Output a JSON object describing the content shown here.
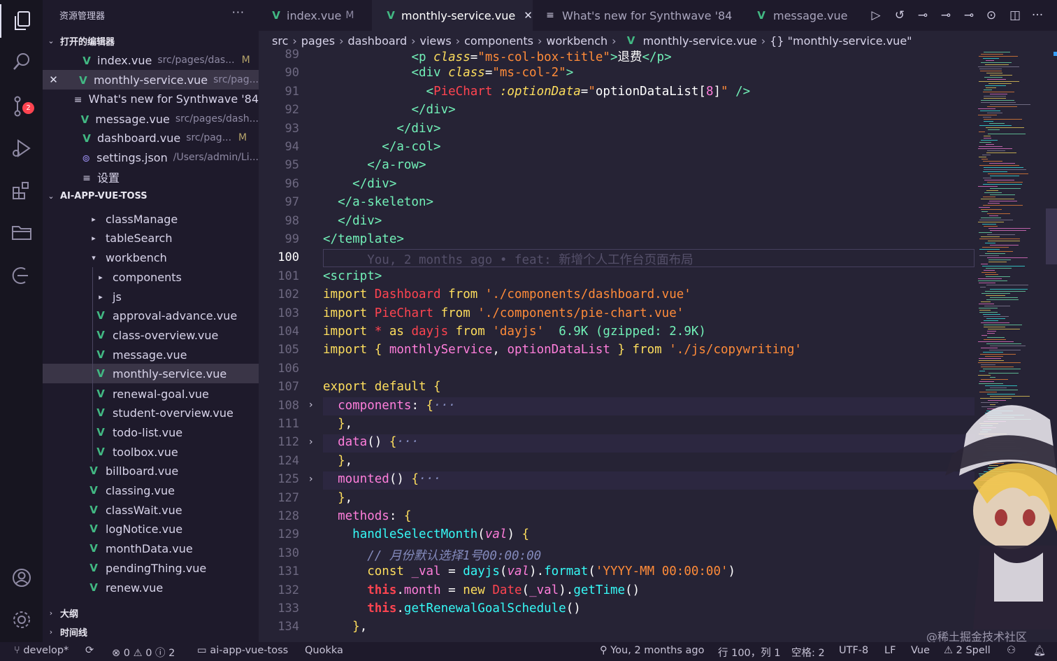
{
  "sidebar": {
    "title": "资源管理器",
    "more": "···",
    "open_editors_title": "打开的编辑器",
    "open_editors": [
      {
        "icon": "vue-icon",
        "name": "index.vue",
        "desc": "src/pages/das...",
        "flag": "M"
      },
      {
        "icon": "vue-icon",
        "name": "monthly-service.vue",
        "desc": "src/pag..."
      },
      {
        "icon": "list-icon",
        "name": "What's new for Synthwave '84"
      },
      {
        "icon": "vue-icon",
        "name": "message.vue",
        "desc": "src/pages/dash..."
      },
      {
        "icon": "vue-icon",
        "name": "dashboard.vue",
        "desc": "src/pag...",
        "flag": "M"
      },
      {
        "icon": "json-icon",
        "name": "settings.json",
        "desc": "/Users/admin/Li..."
      },
      {
        "icon": "list-icon",
        "name": "设置"
      }
    ],
    "project_title": "AI-APP-VUE-TOSS",
    "tree": [
      {
        "type": "folder",
        "name": "classManage"
      },
      {
        "type": "folder",
        "name": "tableSearch"
      },
      {
        "type": "folder-open",
        "name": "workbench"
      },
      {
        "type": "folder",
        "name": "components"
      },
      {
        "type": "folder",
        "name": "js"
      },
      {
        "type": "file",
        "name": "approval-advance.vue"
      },
      {
        "type": "file",
        "name": "class-overview.vue"
      },
      {
        "type": "file",
        "name": "message.vue"
      },
      {
        "type": "file",
        "name": "monthly-service.vue"
      },
      {
        "type": "file",
        "name": "renewal-goal.vue"
      },
      {
        "type": "file",
        "name": "student-overview.vue"
      },
      {
        "type": "file",
        "name": "todo-list.vue"
      },
      {
        "type": "file",
        "name": "toolbox.vue"
      },
      {
        "type": "file",
        "name": "billboard.vue"
      },
      {
        "type": "file",
        "name": "classing.vue"
      },
      {
        "type": "file",
        "name": "classWait.vue"
      },
      {
        "type": "file",
        "name": "logNotice.vue"
      },
      {
        "type": "file",
        "name": "monthData.vue"
      },
      {
        "type": "file",
        "name": "pendingThing.vue"
      },
      {
        "type": "file",
        "name": "renew.vue"
      }
    ],
    "outline": "大纲",
    "timeline": "时间线"
  },
  "activity": {
    "scm_badge": "2"
  },
  "tabs": [
    {
      "name": "index.vue",
      "modified": "M",
      "icon": "vue-icon"
    },
    {
      "name": "monthly-service.vue",
      "active": true,
      "icon": "vue-icon",
      "close": "✕"
    },
    {
      "name": "What's new for Synthwave '84",
      "icon": "list-icon"
    },
    {
      "name": "message.vue",
      "icon": "vue-icon"
    }
  ],
  "breadcrumb": [
    "src",
    "pages",
    "dashboard",
    "views",
    "components",
    "workbench",
    "monthly-service.vue",
    "{} \"monthly-service.vue\""
  ],
  "editor": {
    "line_numbers": [
      "89",
      "90",
      "91",
      "92",
      "93",
      "94",
      "95",
      "96",
      "97",
      "98",
      "99",
      "100",
      "101",
      "102",
      "103",
      "104",
      "105",
      "106",
      "107",
      "108",
      "111",
      "112",
      "124",
      "125",
      "127",
      "128",
      "129",
      "130",
      "131",
      "132",
      "133",
      "134"
    ],
    "current_line": "100",
    "blame": "You, 2 months ago • feat: 新增个人工作台页面布局",
    "import_size": "6.9K (gzipped: 2.9K)",
    "comment_line": "// 月份默认选择1号00:00:00"
  },
  "status": {
    "branch": "develop*",
    "errors": "0",
    "warnings": "0",
    "infos": "2",
    "folder": "ai-app-vue-toss",
    "quokka": "Quokka",
    "blame": "You, 2 months ago",
    "position": "行 100，列 1",
    "spaces": "空格: 2",
    "encoding": "UTF-8",
    "eol": "LF",
    "language": "Vue",
    "spell": "2 Spell"
  },
  "watermark": "@稀土掘金技术社区",
  "colors": {
    "bg": "#262335",
    "sidebar": "#1e1a2b",
    "accent": "#ff7edb",
    "tag": "#72f1b8",
    "keyword": "#fede5d",
    "string": "#ff8b39",
    "function": "#36f9f6"
  }
}
